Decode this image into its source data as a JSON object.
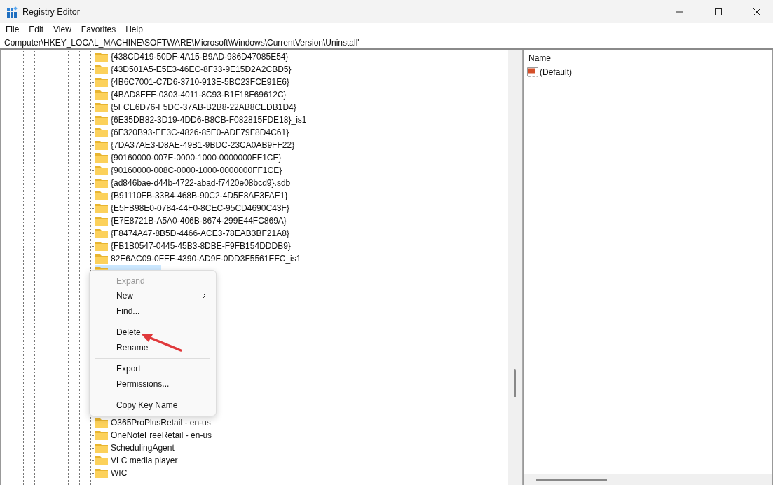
{
  "window": {
    "title": "Registry Editor"
  },
  "menu_bar": [
    "File",
    "Edit",
    "View",
    "Favorites",
    "Help"
  ],
  "address_bar": {
    "value": "Computer\\HKEY_LOCAL_MACHINE\\SOFTWARE\\Microsoft\\Windows\\CurrentVersion\\Uninstall'"
  },
  "tree": {
    "items": [
      {
        "label": "{438CD419-50DF-4A15-B9AD-986D47085E54}",
        "selected": false
      },
      {
        "label": "{43D501A5-E5E3-46EC-8F33-9E15D2A2CBD5}",
        "selected": false
      },
      {
        "label": "{4B6C7001-C7D6-3710-913E-5BC23FCE91E6}",
        "selected": false
      },
      {
        "label": "{4BAD8EFF-0303-4011-8C93-B1F18F69612C}",
        "selected": false
      },
      {
        "label": "{5FCE6D76-F5DC-37AB-B2B8-22AB8CEDB1D4}",
        "selected": false
      },
      {
        "label": "{6E35DB82-3D19-4DD6-B8CB-F082815FDE18}_is1",
        "selected": false
      },
      {
        "label": "{6F320B93-EE3C-4826-85E0-ADF79F8D4C61}",
        "selected": false
      },
      {
        "label": "{7DA37AE3-D8AE-49B1-9BDC-23CA0AB9FF22}",
        "selected": false
      },
      {
        "label": "{90160000-007E-0000-1000-0000000FF1CE}",
        "selected": false
      },
      {
        "label": "{90160000-008C-0000-1000-0000000FF1CE}",
        "selected": false
      },
      {
        "label": "{ad846bae-d44b-4722-abad-f7420e08bcd9}.sdb",
        "selected": false
      },
      {
        "label": "{B91110FB-33B4-468B-90C2-4D5E8AE3FAE1}",
        "selected": false
      },
      {
        "label": "{E5FB98E0-0784-44F0-8CEC-95CD4690C43F}",
        "selected": false
      },
      {
        "label": "{E7E8721B-A5A0-406B-8674-299E44FC869A}",
        "selected": false
      },
      {
        "label": "{F8474A47-8B5D-4466-ACE3-78EAB3BF21A8}",
        "selected": false
      },
      {
        "label": "{FB1B0547-0445-45B3-8DBE-F9FB154DDDB9}",
        "selected": false
      },
      {
        "label": "82E6AC09-0FEF-4390-AD9F-0DD3F5561EFC_is1",
        "selected": false
      },
      {
        "selected": true
      }
    ],
    "items_after_menu": [
      {
        "label": "O365ProPlusRetail - en-us",
        "selected": false
      },
      {
        "label": "OneNoteFreeRetail - en-us",
        "selected": false
      },
      {
        "label": "SchedulingAgent",
        "selected": false
      },
      {
        "label": "VLC media player",
        "selected": false
      },
      {
        "label": "WIC",
        "selected": false
      }
    ]
  },
  "context_menu": {
    "items": [
      {
        "kind": "item",
        "label": "Expand",
        "disabled": true
      },
      {
        "kind": "submenu",
        "label": "New",
        "disabled": false
      },
      {
        "kind": "item",
        "label": "Find...",
        "disabled": false
      },
      {
        "kind": "separator"
      },
      {
        "kind": "item",
        "label": "Delete",
        "disabled": false
      },
      {
        "kind": "item",
        "label": "Rename",
        "disabled": false
      },
      {
        "kind": "separator"
      },
      {
        "kind": "item",
        "label": "Export",
        "disabled": false
      },
      {
        "kind": "item",
        "label": "Permissions...",
        "disabled": false
      },
      {
        "kind": "separator"
      },
      {
        "kind": "item",
        "label": "Copy Key Name",
        "disabled": false
      }
    ]
  },
  "values_pane": {
    "columns": [
      "Name"
    ],
    "values": [
      {
        "kind": "string",
        "name": "(Default)"
      }
    ]
  }
}
